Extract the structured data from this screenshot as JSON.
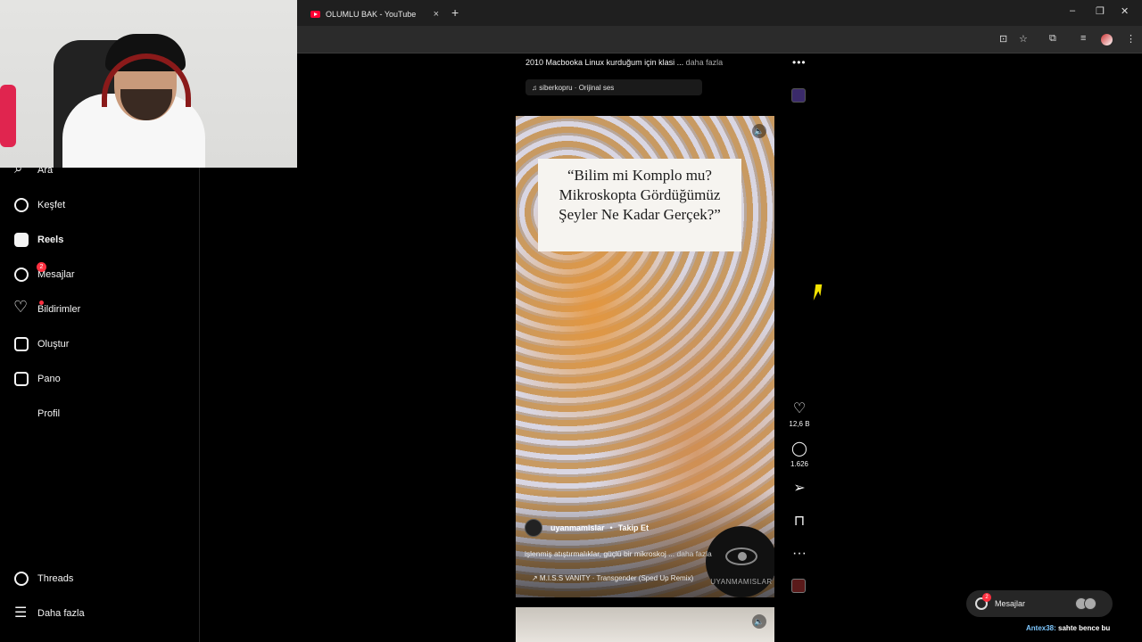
{
  "browser": {
    "tab_title": "OLUMLU BAK - YouTube",
    "new_tab": "+",
    "tab_close": "×",
    "minimize": "–",
    "restore": "❐",
    "close": "✕"
  },
  "sidebar": {
    "items": [
      {
        "label": "Ara",
        "icon": "search-icon"
      },
      {
        "label": "Keşfet",
        "icon": "compass-icon"
      },
      {
        "label": "Reels",
        "icon": "reels-icon"
      },
      {
        "label": "Mesajlar",
        "icon": "messenger-icon",
        "badge": "2"
      },
      {
        "label": "Bildirimler",
        "icon": "heart-icon"
      },
      {
        "label": "Oluştur",
        "icon": "plus-square-icon"
      },
      {
        "label": "Pano",
        "icon": "chart-icon"
      },
      {
        "label": "Profil",
        "icon": "profile-avatar"
      }
    ],
    "bottom": [
      {
        "label": "Threads",
        "icon": "threads-icon"
      },
      {
        "label": "Daha fazla",
        "icon": "menu-icon"
      }
    ]
  },
  "previous_reel": {
    "caption": "2010 Macbooka Linux kurduğum için klasi ...",
    "more": "daha fazla",
    "audio": "siberkopru · Orijinal ses"
  },
  "reel": {
    "title_card": "“Bilim mi Komplo mu? Mikroskopta Gördüğümüz Şeyler Ne Kadar Gerçek?”",
    "author": "uyanmamislar",
    "separator": "•",
    "follow": "Takip Et",
    "caption": "işlenmiş atıştırmalıklar, güçlü bir mikroskoj ...",
    "more": "daha fazla",
    "audio": "↗ M.I.S.S VANITY · Transgender (Sped Up Remix)",
    "watermark": "UYANMAMISLAR",
    "likes": "12,6 B",
    "comments": "1.626"
  },
  "chat": {
    "popup_label": "Mesajlar",
    "popup_badge": "2",
    "stream_nick": "Antex38:",
    "stream_msg": "sahte bence bu"
  },
  "colors": {
    "background": "#000000",
    "accent_red": "#ff3040",
    "cursor": "#f4e300"
  }
}
